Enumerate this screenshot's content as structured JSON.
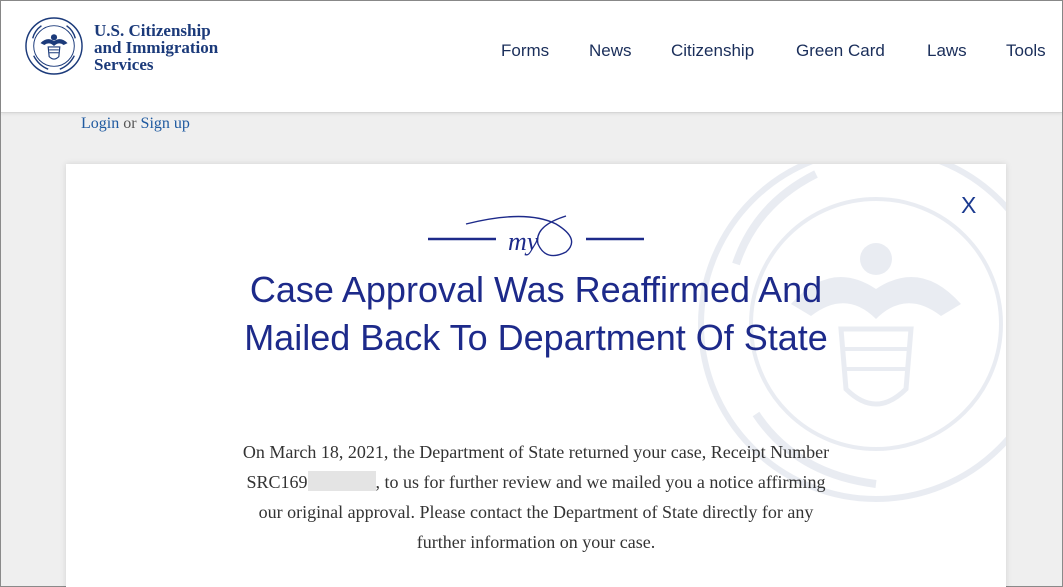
{
  "header": {
    "agency_line1": "U.S. Citizenship",
    "agency_line2": "and Immigration",
    "agency_line3": "Services",
    "nav": [
      {
        "label": "Forms"
      },
      {
        "label": "News"
      },
      {
        "label": "Citizenship"
      },
      {
        "label": "Green Card"
      },
      {
        "label": "Laws"
      },
      {
        "label": "Tools"
      }
    ]
  },
  "account": {
    "login": "Login",
    "or": "or",
    "signup": "Sign up"
  },
  "modal": {
    "close": "X",
    "flourish_text": "my",
    "title": "Case Approval Was Reaffirmed And Mailed Back To Department Of State",
    "body_before": "On March 18, 2021, the Department of State returned your case, Receipt Number SRC169",
    "body_after": ", to us for further review and we mailed you a notice affirming our original approval. Please contact the Department of State directly for any further information on your case."
  },
  "colors": {
    "brand": "#1b3a7a",
    "title": "#1d2a8a",
    "link": "#1f5aa0",
    "background": "#efefef"
  },
  "icons": {
    "seal": "dhs-seal-icon",
    "watermark": "dhs-seal-watermark"
  }
}
